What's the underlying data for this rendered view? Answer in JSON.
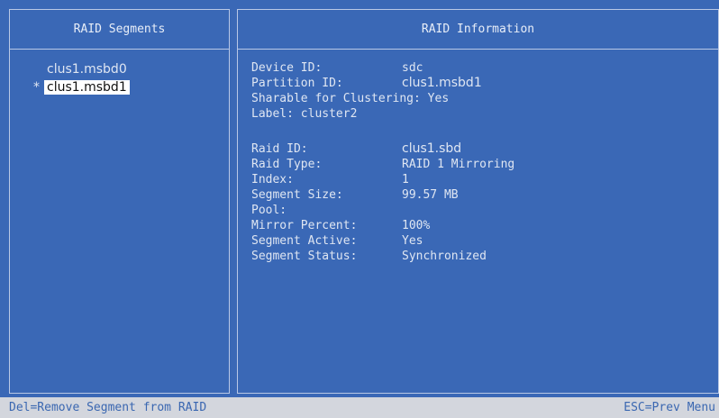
{
  "left_panel": {
    "title": "RAID Segments",
    "items": [
      {
        "marker": "",
        "label": "clus1.msbd0"
      },
      {
        "marker": "*",
        "label": "clus1.msbd1"
      }
    ]
  },
  "right_panel": {
    "title": "RAID Information",
    "device": [
      {
        "key": "Device ID:",
        "value": "sdc"
      },
      {
        "key": "Partition ID:",
        "value": "clus1.msbd1"
      },
      {
        "key": "Sharable for Clustering:",
        "value": "Yes"
      },
      {
        "key": "Label:",
        "value": "cluster2"
      }
    ],
    "raid": [
      {
        "key": "Raid ID:",
        "value": "clus1.sbd"
      },
      {
        "key": "Raid Type:",
        "value": "RAID 1 Mirroring"
      },
      {
        "key": "Index:",
        "value": "1"
      },
      {
        "key": "Segment Size:",
        "value": "99.57 MB"
      },
      {
        "key": "Pool:",
        "value": ""
      },
      {
        "key": "Mirror Percent:",
        "value": "100%"
      },
      {
        "key": "Segment Active:",
        "value": "Yes"
      },
      {
        "key": "Segment Status:",
        "value": "Synchronized"
      }
    ]
  },
  "status_bar": {
    "left": "Del=Remove Segment from RAID",
    "right": "ESC=Prev Menu"
  }
}
